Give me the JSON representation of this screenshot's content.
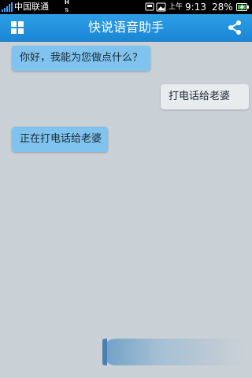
{
  "status_bar": {
    "carrier": "中国联通",
    "network_type": "H",
    "ampm": "上午",
    "time": "9:13",
    "battery": "28%"
  },
  "header": {
    "title": "快说语音助手",
    "menu_icon": "grid-icon",
    "share_icon": "share-icon"
  },
  "messages": [
    {
      "side": "left",
      "text": "你好，我能为您做点什么？"
    },
    {
      "side": "right",
      "text": "打电话给老婆"
    },
    {
      "side": "left",
      "text": "正在打电话给老婆"
    }
  ],
  "colors": {
    "accent": "#1a86d6",
    "background": "#c9d0d6",
    "assistant_bubble": "#7fc3ee",
    "user_bubble": "#e7ecef"
  }
}
